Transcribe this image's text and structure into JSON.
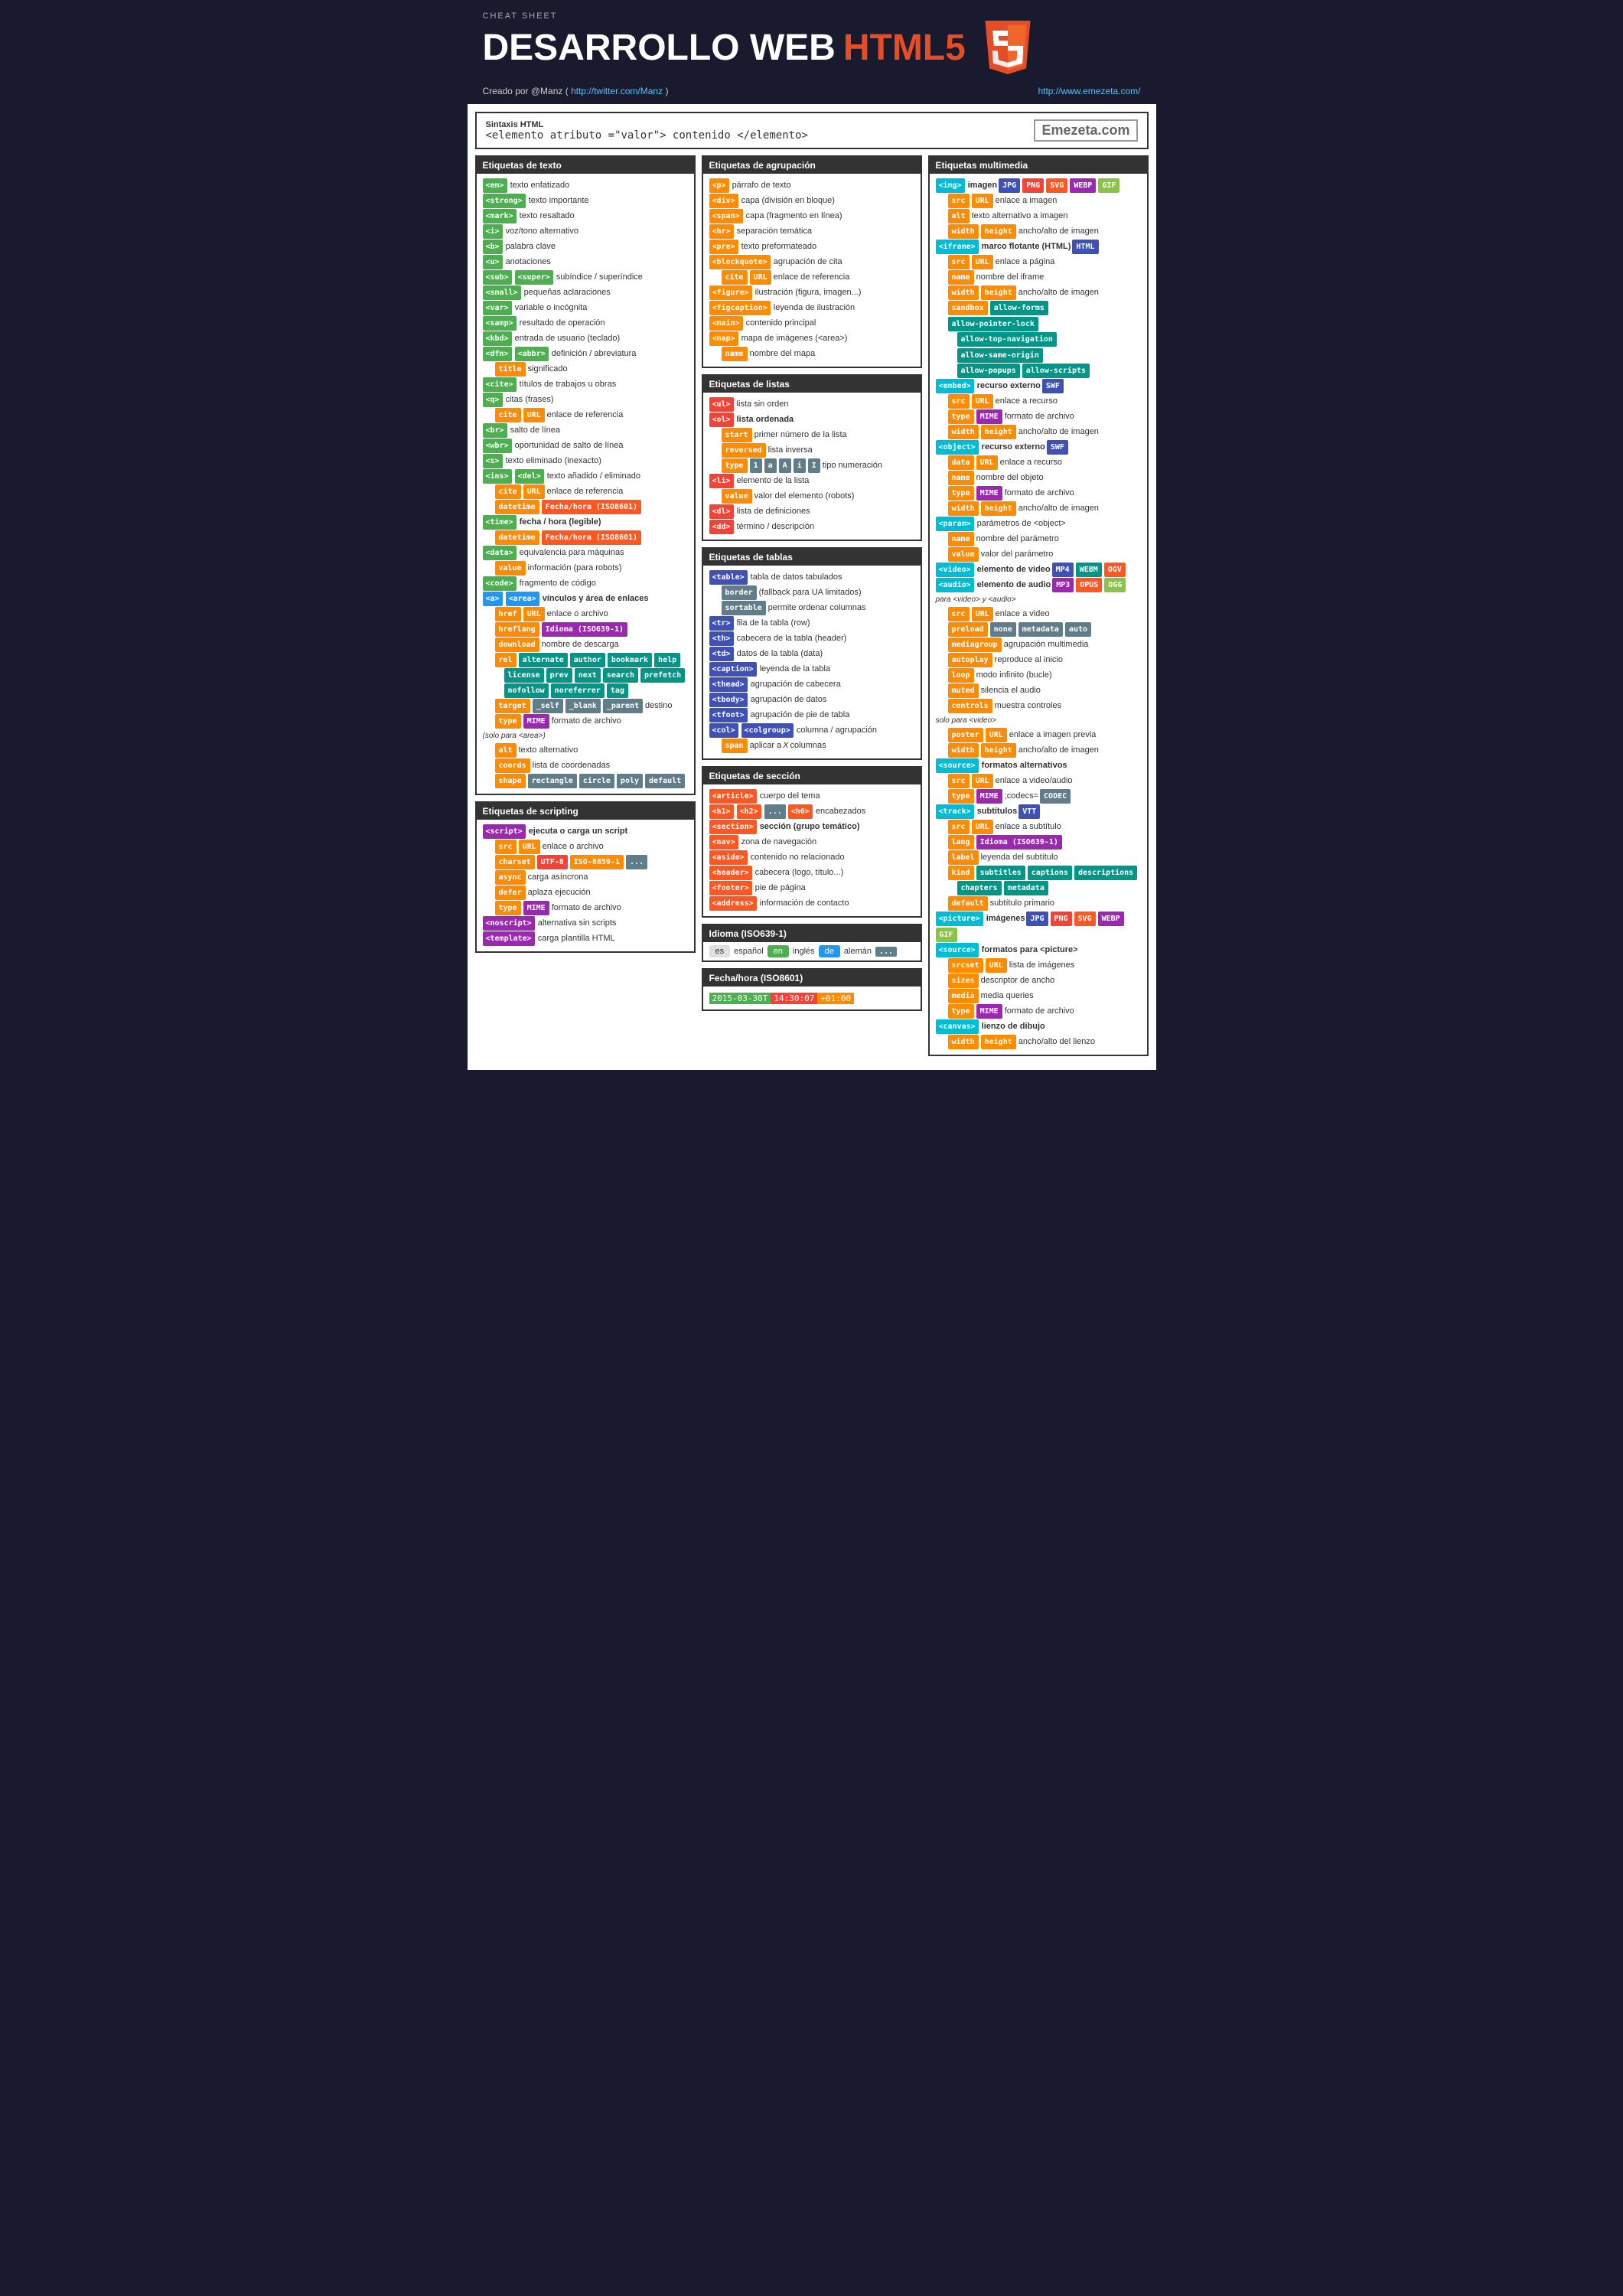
{
  "header": {
    "cheat_sheet": "CHEAT SHEET",
    "title_main": "DESARROLLO WEB ",
    "title_html5": "HTML5",
    "author_label": "Creado por @Manz ( ",
    "author_link": "http://twitter.com/Manz",
    "author_end": " )",
    "site": "http://www.emezeta.com/"
  },
  "syntax": {
    "title": "Sintaxis HTML",
    "code": "<elemento  atributo =\"valor\"> contenido </elemento>",
    "logo": "Emezeta.com"
  },
  "sections": {
    "text_tags": "Etiquetas de texto",
    "grouping_tags": "Etiquetas de agrupación",
    "multimedia_tags": "Etiquetas multimedia",
    "list_tags": "Etiquetas de listas",
    "table_tags": "Etiquetas de tablas",
    "script_tags": "Etiquetas de scripting",
    "section_tags": "Etiquetas de sección",
    "idioma": "Idioma (ISO639-1)",
    "fecha": "Fecha/hora (ISO8601)"
  }
}
